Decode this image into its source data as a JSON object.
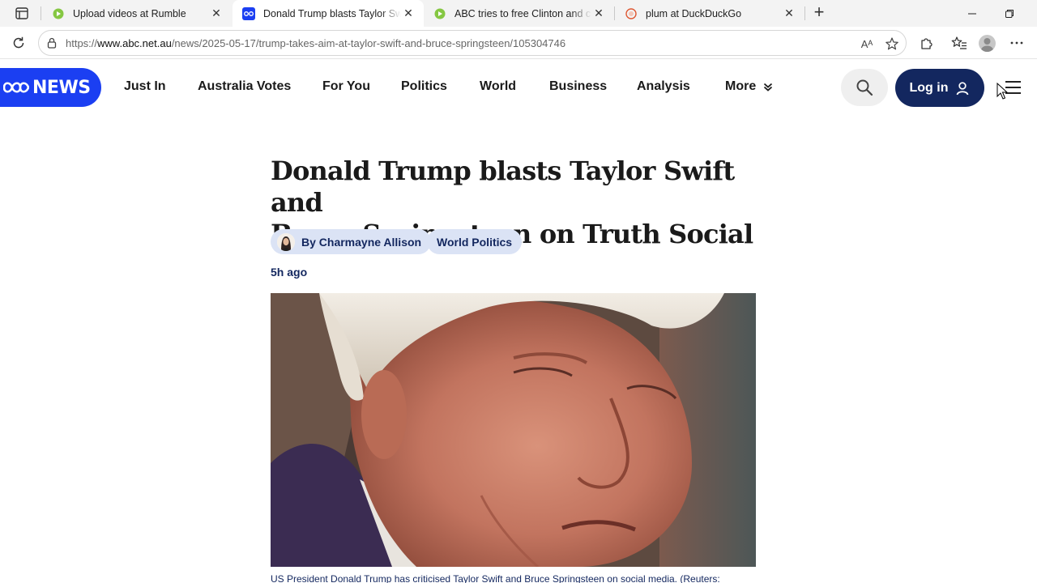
{
  "browser": {
    "tabs": [
      {
        "title": "Upload videos at Rumble",
        "active": false,
        "icon": "rumble-icon"
      },
      {
        "title": "Donald Trump blasts Taylor Swift and Bruce Springsteen",
        "active": true,
        "icon": "abc-icon"
      },
      {
        "title": "ABC tries to free Clinton and curse",
        "active": false,
        "icon": "rumble-icon"
      },
      {
        "title": "plum at DuckDuckGo",
        "active": false,
        "icon": "duckduckgo-icon"
      }
    ],
    "new_tab_label": "+",
    "url_prefix": "https://",
    "url_host": "www.abc.net.au",
    "url_path": "/news/2025-05-17/trump-takes-aim-at-taylor-swift-and-bruce-springsteen/105304746",
    "read_aloud_label": "Aᴬ"
  },
  "site": {
    "logo_text": "NEWS",
    "nav": [
      "Just In",
      "Australia Votes",
      "For You",
      "Politics",
      "World",
      "Business",
      "Analysis",
      "More"
    ],
    "login_label": "Log in"
  },
  "article": {
    "headline_line1": "Donald Trump blasts Taylor Swift and",
    "headline_line2": "Bruce Springsteen on Truth Social",
    "author": "By Charmayne Allison",
    "topic": "World Politics",
    "timestamp": "5h ago",
    "caption": "US President Donald Trump has criticised Taylor Swift and Bruce Springsteen on social media. (Reuters: "
  },
  "colors": {
    "abc_blue": "#1b3ff2",
    "navy": "#13275f",
    "chip_bg": "#dbe3f5"
  }
}
